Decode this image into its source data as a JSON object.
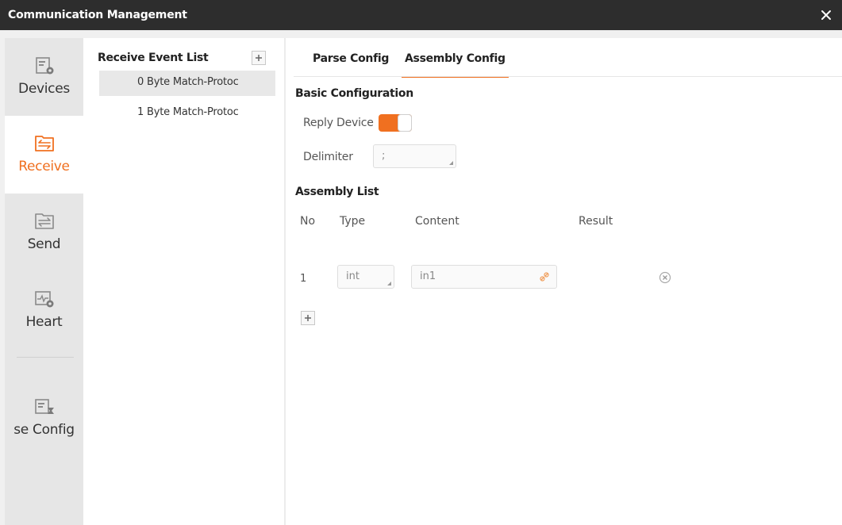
{
  "window": {
    "title": "Communication Management"
  },
  "nav": {
    "items": [
      {
        "label": "Devices",
        "icon": "devices-settings-icon"
      },
      {
        "label": "Receive",
        "icon": "receive-folder-icon",
        "active": true
      },
      {
        "label": "Send",
        "icon": "send-folder-icon"
      },
      {
        "label": "Heart",
        "icon": "heartbeat-settings-icon"
      },
      {
        "label": "se Config",
        "icon": "response-config-icon"
      }
    ]
  },
  "event_list": {
    "header": "Receive Event List",
    "items": [
      {
        "label": "0 Byte Match-Protoc",
        "selected": true
      },
      {
        "label": "1 Byte Match-Protoc"
      }
    ]
  },
  "tabs": [
    {
      "label": "Parse Config"
    },
    {
      "label": "Assembly Config",
      "active": true
    }
  ],
  "basic": {
    "title": "Basic Configuration",
    "reply_device_label": "Reply Device",
    "reply_device_on": true,
    "delimiter_label": "Delimiter",
    "delimiter_value": ";"
  },
  "assembly": {
    "title": "Assembly List",
    "columns": {
      "no": "No",
      "type": "Type",
      "content": "Content",
      "result": "Result"
    },
    "rows": [
      {
        "no": "1",
        "type": "int",
        "content": "in1",
        "result": ""
      }
    ]
  },
  "colors": {
    "accent": "#f07020",
    "titlebar": "#2d2d2d"
  }
}
